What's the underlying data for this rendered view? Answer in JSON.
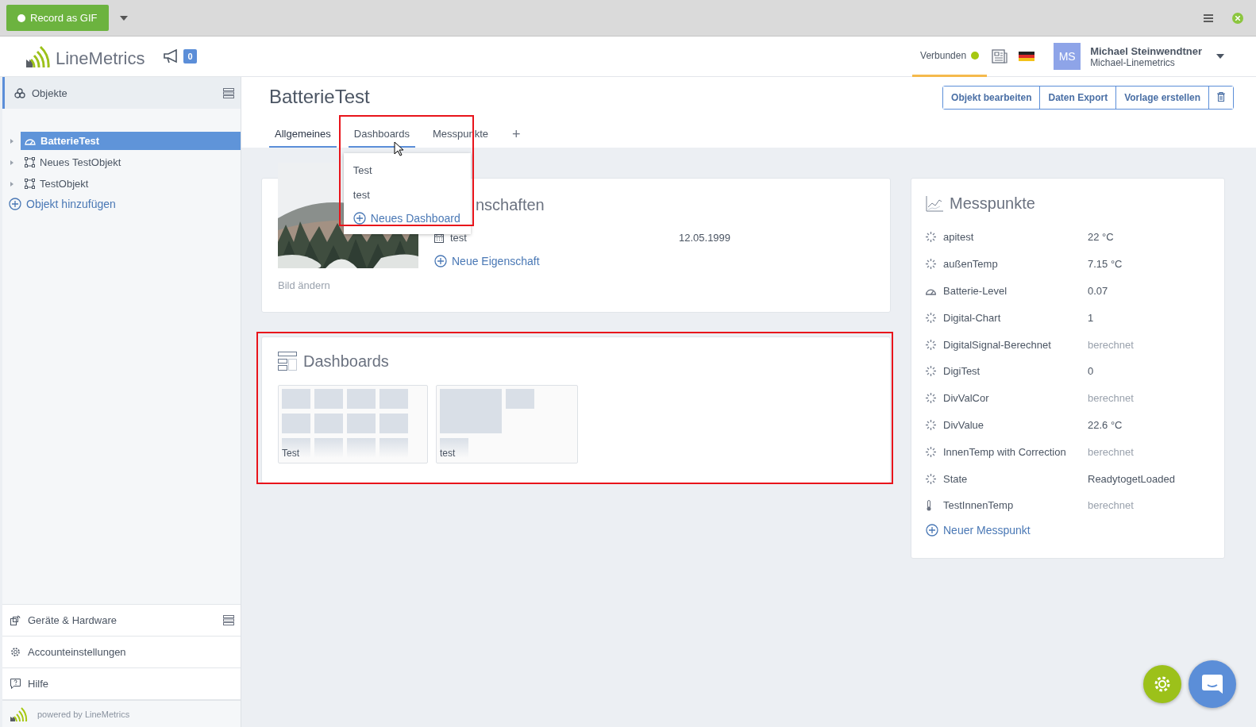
{
  "toolbar": {
    "record_button": "Record as GIF"
  },
  "header": {
    "logo_text": "LineMetrics",
    "notifications": "0",
    "connection": {
      "label": "Verbunden",
      "connected": true
    },
    "user": {
      "initials": "MS",
      "name": "Michael Steinwendtner",
      "account": "Michael-Linemetrics"
    }
  },
  "sidebar": {
    "section": "Objekte",
    "tree": [
      {
        "label": "BatterieTest",
        "kind": "gauge",
        "selected": true
      },
      {
        "label": "Neues TestObjekt",
        "kind": "frame",
        "selected": false
      },
      {
        "label": "TestObjekt",
        "kind": "frame",
        "selected": false
      }
    ],
    "add_link": "Objekt hinzufügen",
    "nav": [
      {
        "label": "Geräte & Hardware",
        "kind": "devices"
      },
      {
        "label": "Accounteinstellungen",
        "kind": "settings"
      },
      {
        "label": "Hilfe",
        "kind": "help"
      }
    ],
    "footer": "powered by LineMetrics"
  },
  "page": {
    "title": "BatterieTest",
    "actions": [
      "Objekt bearbeiten",
      "Daten Export",
      "Vorlage erstellen"
    ],
    "tabs": [
      {
        "label": "Allgemeines",
        "selected": true,
        "open": false
      },
      {
        "label": "Dashboards",
        "selected": false,
        "open": true
      },
      {
        "label": "Messpunkte",
        "selected": false,
        "open": false
      }
    ],
    "tab_add": "+",
    "tab_menu": {
      "items": [
        "Test",
        "test"
      ],
      "add": "Neues Dashboard"
    }
  },
  "properties": {
    "image_link": "Bild ändern",
    "title": "nschaften",
    "rows": [
      {
        "name": "test",
        "value": "12.05.1999"
      }
    ],
    "add": "Neue Eigenschaft"
  },
  "dashboards": {
    "title": "Dashboards",
    "items": [
      {
        "name": "Test",
        "kind": "grid"
      },
      {
        "name": "test",
        "kind": "mixed"
      }
    ]
  },
  "measurements": {
    "title": "Messpunkte",
    "rows": [
      {
        "name": "apitest",
        "kind": "sensor",
        "value": "22 °C",
        "computed": false
      },
      {
        "name": "außenTemp",
        "kind": "sensor",
        "value": "7.15 °C",
        "computed": false
      },
      {
        "name": "Batterie-Level",
        "kind": "gauge",
        "value": "0.07",
        "computed": false
      },
      {
        "name": "Digital-Chart",
        "kind": "sensor",
        "value": "1",
        "computed": false
      },
      {
        "name": "DigitalSignal-Berechnet",
        "kind": "sensor",
        "value": "berechnet",
        "computed": true
      },
      {
        "name": "DigiTest",
        "kind": "sensor",
        "value": "0",
        "computed": false
      },
      {
        "name": "DivValCor",
        "kind": "sensor",
        "value": "berechnet",
        "computed": true
      },
      {
        "name": "DivValue",
        "kind": "sensor",
        "value": "22.6 °C",
        "computed": false
      },
      {
        "name": "InnenTemp with Correction",
        "kind": "sensor",
        "value": "berechnet",
        "computed": true
      },
      {
        "name": "State",
        "kind": "sensor",
        "value": "ReadytogetLoaded",
        "computed": false
      },
      {
        "name": "TestInnenTemp",
        "kind": "thermometer",
        "value": "berechnet",
        "computed": true
      }
    ],
    "add": "Neuer Messpunkt"
  }
}
